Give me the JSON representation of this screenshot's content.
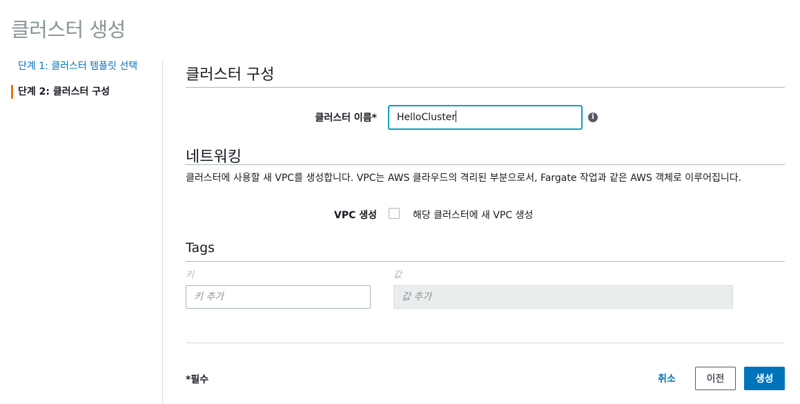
{
  "page": {
    "title": "클러스터 생성"
  },
  "steps": [
    {
      "label": "단계 1: 클러스터 템플릿 선택"
    },
    {
      "label": "단계 2: 클러스터 구성"
    }
  ],
  "cluster_config": {
    "title": "클러스터 구성",
    "name_label": "클러스터 이름*",
    "name_value": "HelloCluster",
    "info_icon": "i"
  },
  "networking": {
    "title": "네트워킹",
    "description": "클러스터에 사용할 새 VPC를 생성합니다. VPC는 AWS 클라우드의 격리된 부분으로서, Fargate 작업과 같은 AWS 객체로 이루어집니다.",
    "vpc_label": "VPC 생성",
    "vpc_checkbox_label": "해당 클러스터에 새 VPC 생성",
    "vpc_checked": false
  },
  "tags": {
    "title": "Tags",
    "key_header": "키",
    "value_header": "값",
    "key_placeholder": "키 추가",
    "value_placeholder": "값 추가"
  },
  "footer": {
    "required_note": "*필수",
    "cancel_label": "취소",
    "previous_label": "이전",
    "create_label": "생성"
  },
  "colors": {
    "link": "#0073bb",
    "primary": "#0073bb",
    "step_accent": "#ec7211",
    "focus": "#00a1c9"
  }
}
